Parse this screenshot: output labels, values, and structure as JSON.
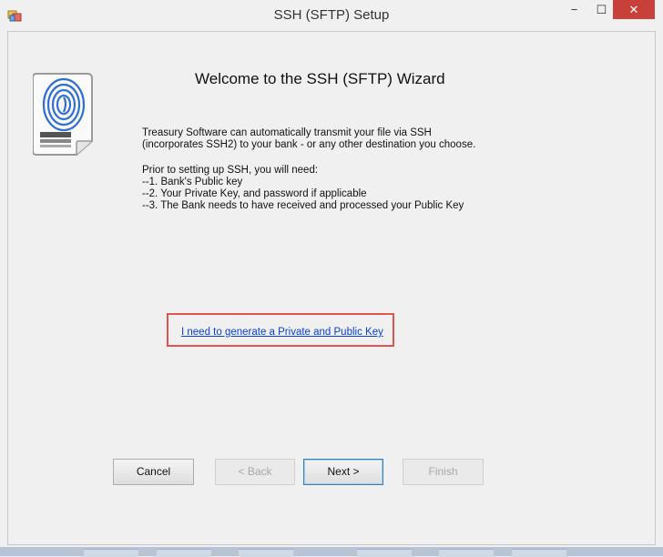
{
  "window": {
    "title": "SSH (SFTP) Setup"
  },
  "controls": {
    "minimize": "−",
    "maximize": "☐",
    "close": "✕"
  },
  "icons": {
    "app": "app-window-icon",
    "logo": "fingerprint-document-icon"
  },
  "wizard": {
    "heading": "Welcome to the SSH (SFTP) Wizard",
    "intro_lines": [
      "Treasury Software can automatically transmit your file via SSH",
      "(incorporates SSH2) to your bank - or any other destination you choose."
    ],
    "prereq_lines": [
      "Prior to setting up SSH, you will need:",
      "--1. Bank's Public key",
      "--2. Your Private Key, and password if applicable",
      "--3. The Bank needs to have received and processed your Public Key"
    ],
    "generate_key_link": "I need to generate a Private and Public Key"
  },
  "buttons": {
    "cancel": "Cancel",
    "back": "< Back",
    "next": "Next >",
    "finish": "Finish"
  },
  "colors": {
    "close_button": "#c7403a",
    "link": "#0b3fd6",
    "highlight": "#e05550"
  }
}
